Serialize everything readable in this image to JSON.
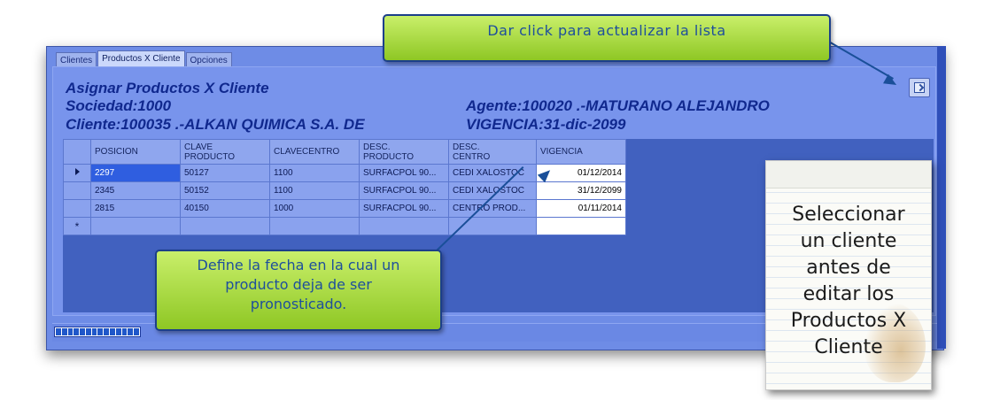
{
  "tabs": [
    {
      "label": "Clientes"
    },
    {
      "label": "Productos X Cliente"
    },
    {
      "label": "Opciones"
    }
  ],
  "header": {
    "title": "Asignar Productos  X Cliente",
    "sociedad": "Sociedad:1000",
    "cliente": "Cliente:100035   .-ALKAN QUIMICA S.A. DE",
    "agente": "Agente:100020   .-MATURANO ALEJANDRO",
    "vigencia": "VIGENCIA:31-dic-2099"
  },
  "toolbar": {
    "refresh_icon": "refresh-icon"
  },
  "grid": {
    "columns": [
      "POSICION",
      "CLAVE\nPRODUCTO",
      "CLAVECENTRO",
      "DESC.\nPRODUCTO",
      "DESC.\nCENTRO",
      "VIGENCIA"
    ],
    "rows": [
      [
        "2297",
        "50127",
        "1100",
        "SURFACPOL 90...",
        "CEDI XALOSTOC",
        "01/12/2014"
      ],
      [
        "2345",
        "50152",
        "1100",
        "SURFACPOL 90...",
        "CEDI XALOSTOC",
        "31/12/2099"
      ],
      [
        "2815",
        "40150",
        "1000",
        "SURFACPOL 90...",
        "CENTRO PROD...",
        "01/11/2014"
      ]
    ],
    "new_row_marker": "*"
  },
  "callouts": {
    "top": "Dar click para actualizar la lista",
    "bottom": "Define la fecha en la cual un\nproducto deja de ser\npronosticado."
  },
  "note": {
    "text": "Seleccionar\nun cliente\nantes de\neditar los\nProductos X\nCliente"
  },
  "colors": {
    "window_bg": "#6e8ce6",
    "title_text": "#10288e",
    "callout_green": "#a8dc3c",
    "selected_cell": "#2f5ee0"
  }
}
